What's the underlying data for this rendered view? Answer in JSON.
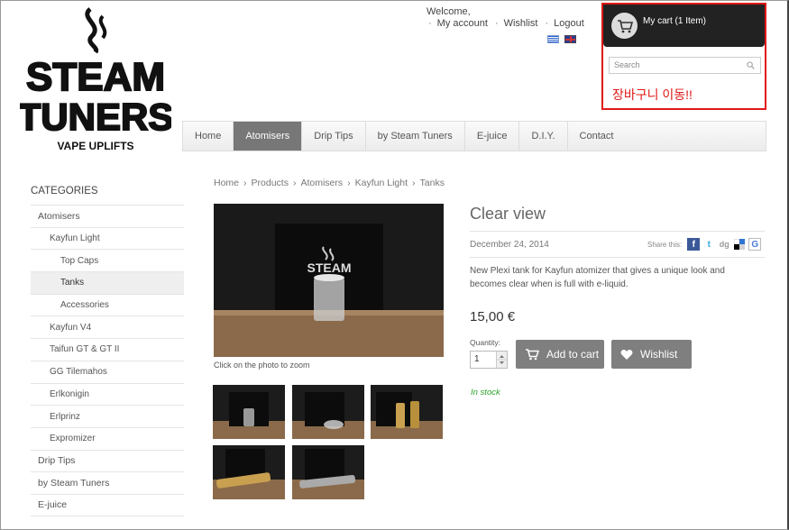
{
  "logo": {
    "line1": "STEAM",
    "line2": "TUNERS",
    "tagline": "VAPE UPLIFTS"
  },
  "header": {
    "welcome": "Welcome,",
    "links": [
      "My account",
      "Wishlist",
      "Logout"
    ],
    "languages": [
      "greek-flag-icon",
      "english-flag-icon"
    ]
  },
  "cart": {
    "label": "My cart (1 Item)"
  },
  "search": {
    "placeholder": "Search"
  },
  "annotation": {
    "text": "장바구니 이동!!",
    "color": "#e01818"
  },
  "nav": {
    "items": [
      "Home",
      "Atomisers",
      "Drip Tips",
      "by Steam Tuners",
      "E-juice",
      "D.I.Y.",
      "Contact"
    ],
    "active": "Atomisers"
  },
  "sidebar": {
    "title": "CATEGORIES",
    "items": [
      {
        "label": "Atomisers",
        "level": 1
      },
      {
        "label": "Kayfun Light",
        "level": 2
      },
      {
        "label": "Top Caps",
        "level": 3
      },
      {
        "label": "Tanks",
        "level": 3,
        "selected": true
      },
      {
        "label": "Accessories",
        "level": 3
      },
      {
        "label": "Kayfun V4",
        "level": 2
      },
      {
        "label": "Taifun GT & GT II",
        "level": 2
      },
      {
        "label": "GG Tilemahos",
        "level": 2
      },
      {
        "label": "Erlkonigin",
        "level": 2
      },
      {
        "label": "Erlprinz",
        "level": 2
      },
      {
        "label": "Expromizer",
        "level": 2
      },
      {
        "label": "Drip Tips",
        "level": 1
      },
      {
        "label": "by Steam Tuners",
        "level": 1
      },
      {
        "label": "E-juice",
        "level": 1
      }
    ]
  },
  "breadcrumb": [
    "Home",
    "Products",
    "Atomisers",
    "Kayfun Light",
    "Tanks"
  ],
  "product": {
    "title": "Clear view",
    "date": "December 24, 2014",
    "share_label": "Share this:",
    "description": "New Plexi tank for Kayfun atomizer that gives a unique look and becomes clear when is full with e-liquid.",
    "price": "15,00 €",
    "quantity_label": "Quantity:",
    "quantity": "1",
    "add_to_cart": "Add to cart",
    "wishlist": "Wishlist",
    "stock": "In stock",
    "zoom_hint": "Click on the photo to zoom",
    "image_box_text": "STEAM"
  },
  "colors": {
    "nav_active": "#777777",
    "button": "#7f7f7f",
    "stock": "#2aa02a",
    "cart_bar": "#222222"
  }
}
